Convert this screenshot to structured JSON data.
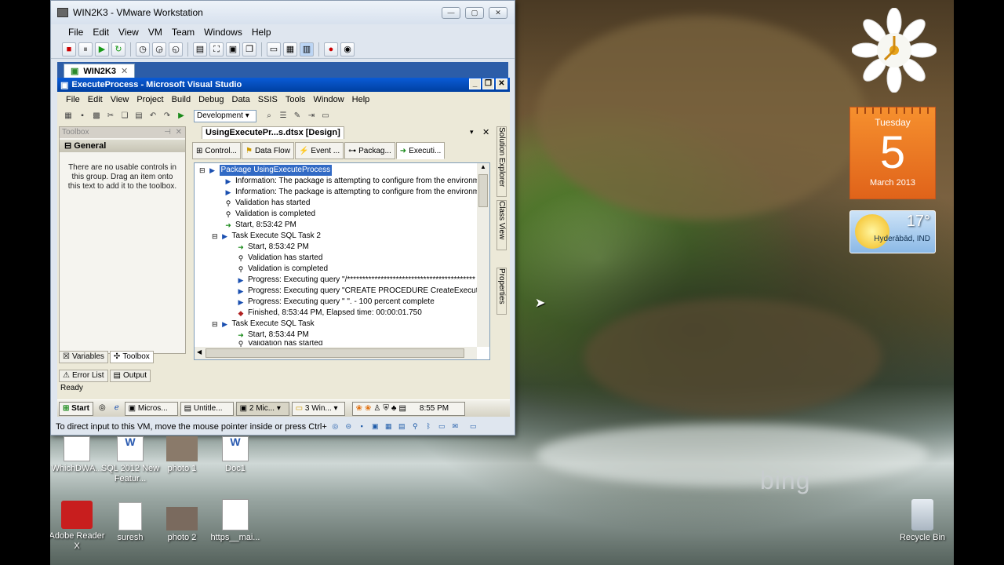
{
  "vmware": {
    "title": "WIN2K3 - VMware Workstation",
    "menu": [
      "File",
      "Edit",
      "View",
      "VM",
      "Team",
      "Windows",
      "Help"
    ],
    "tab_label": "WIN2K3",
    "status_text": "To direct input to this VM, move the mouse pointer inside or press Ctrl+"
  },
  "vs": {
    "title": "ExecuteProcess - Microsoft Visual Studio",
    "menu": [
      "File",
      "Edit",
      "View",
      "Project",
      "Build",
      "Debug",
      "Data",
      "SSIS",
      "Tools",
      "Window",
      "Help"
    ],
    "configuration": "Development",
    "toolbox": {
      "header": "Toolbox",
      "group": "General",
      "empty_text": "There are no usable controls in this group. Drag an item onto this text to add it to the toolbox."
    },
    "lower_tabs": [
      "Variables",
      "Toolbox"
    ],
    "bottom_tabs": [
      "Error List",
      "Output"
    ],
    "status": "Ready",
    "document_tab": "UsingExecutePr...s.dtsx [Design]",
    "designer_tabs": [
      "Control...",
      "Data Flow",
      "Event ...",
      "Packag...",
      "Executi..."
    ],
    "side_tabs": [
      "Solution Explorer",
      "Class View",
      "Properties"
    ],
    "progress_rows": [
      "Package UsingExecuteProcess",
      "Information: The package is attempting to configure from the environm",
      "Information: The package is attempting to configure from the environm",
      "Validation has started",
      "Validation is completed",
      "Start, 8:53:42 PM",
      "Task Execute SQL Task 2",
      "Start, 8:53:42 PM",
      "Validation has started",
      "Validation is completed",
      "Progress: Executing query \"/******************************************",
      "Progress: Executing query \"CREATE PROCEDURE CreateExecutePr",
      "Progress: Executing query \"   \". - 100 percent complete",
      "Finished, 8:53:44 PM, Elapsed time: 00:00:01.750",
      "Task Execute SQL Task",
      "Start, 8:53:44 PM",
      "Validation has started"
    ]
  },
  "guest_taskbar": {
    "start": "Start",
    "items": [
      "Micros...",
      "Untitle...",
      "2 Mic...",
      "3 Win..."
    ],
    "time": "8:55 PM"
  },
  "gadgets": {
    "calendar": {
      "weekday": "Tuesday",
      "day": "5",
      "month_year": "March 2013"
    },
    "weather": {
      "temp": "17°",
      "location": "Hyderābād, IND"
    }
  },
  "desktop": {
    "bing": "bing",
    "icons": [
      {
        "label": "WhichDWA..."
      },
      {
        "label": "SQL 2012 New Featur..."
      },
      {
        "label": "photo 1"
      },
      {
        "label": "Doc1"
      },
      {
        "label": "Adobe Reader X"
      },
      {
        "label": "suresh"
      },
      {
        "label": "photo 2"
      },
      {
        "label": "https__mai..."
      },
      {
        "label": "Recycle Bin"
      }
    ]
  }
}
